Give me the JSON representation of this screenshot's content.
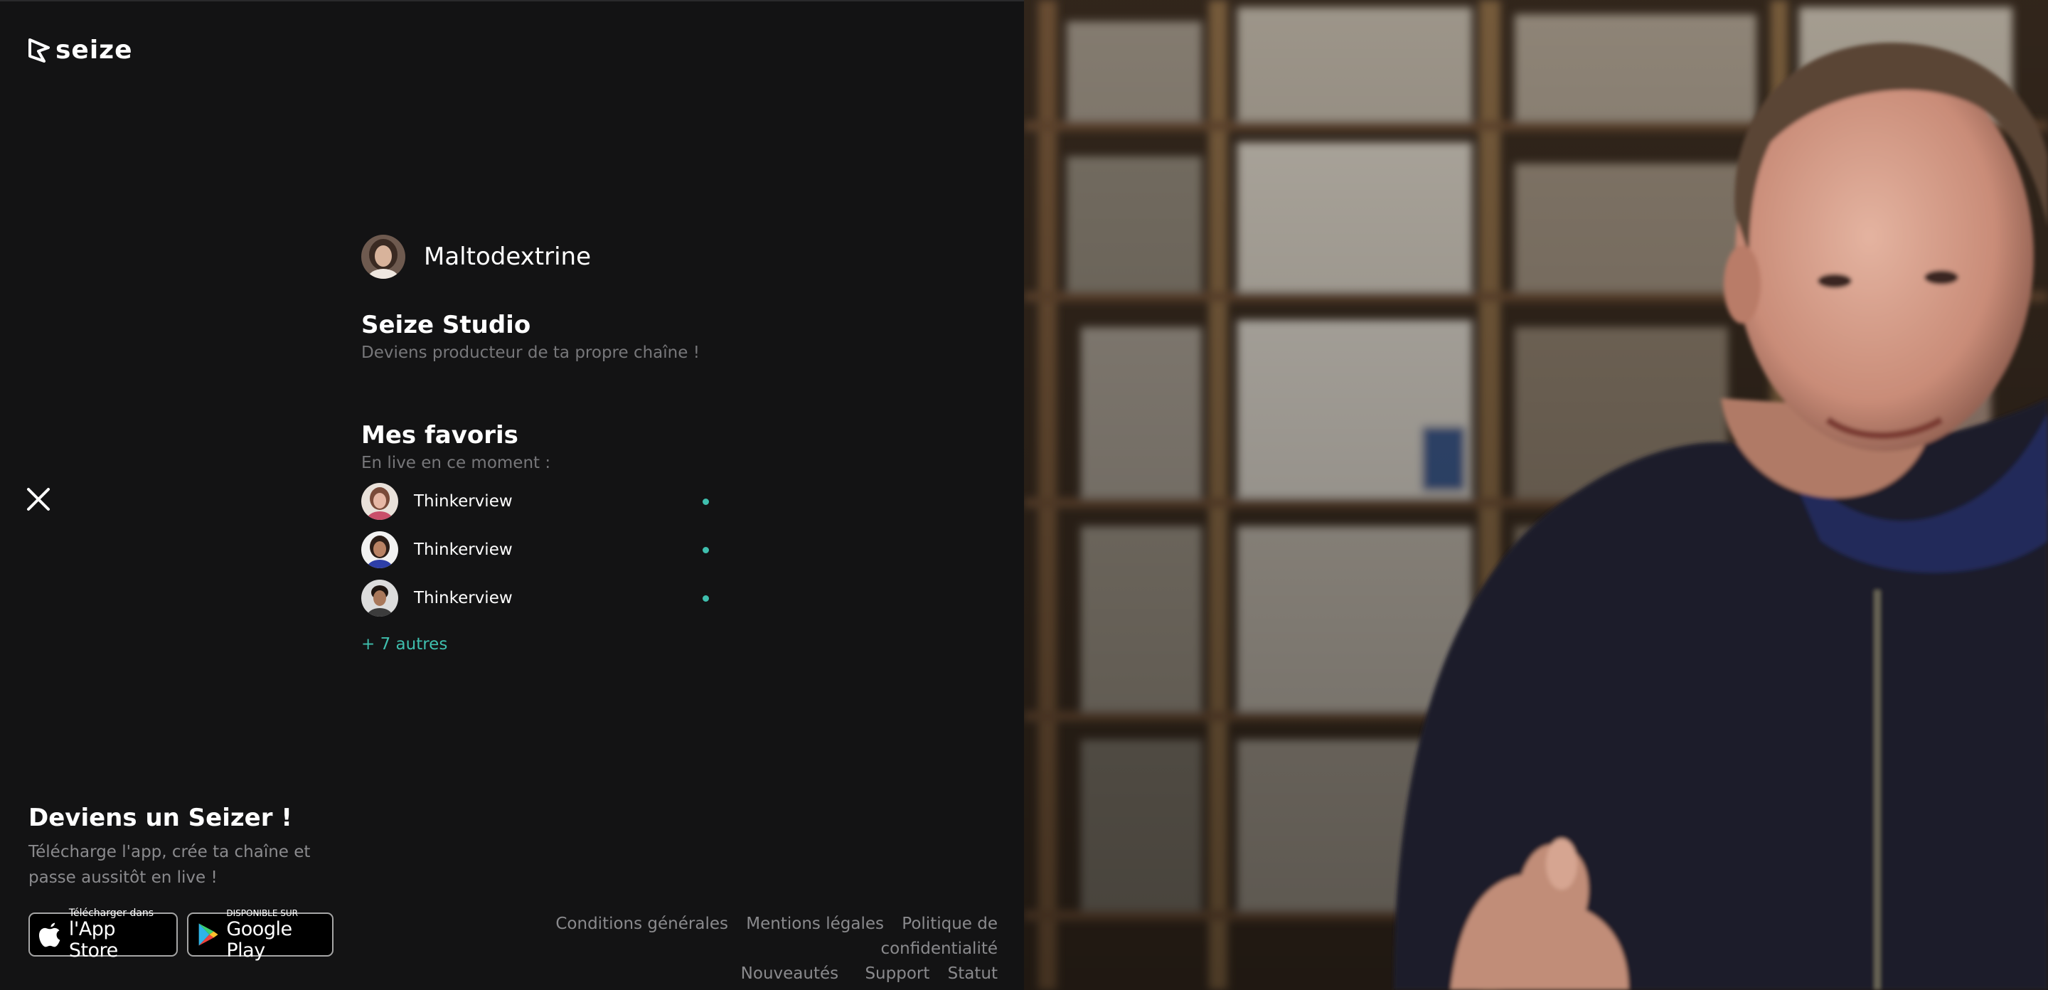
{
  "brand": {
    "name": "seize"
  },
  "profile": {
    "name": "Maltodextrine"
  },
  "studio": {
    "title": "Seize Studio",
    "subtitle": "Deviens producteur de ta propre chaîne !"
  },
  "favorites": {
    "title": "Mes favoris",
    "subtitle": "En live en ce moment :",
    "items": [
      {
        "name": "Thinkerview",
        "live": true
      },
      {
        "name": "Thinkerview",
        "live": true
      },
      {
        "name": "Thinkerview",
        "live": true
      }
    ],
    "more": "+ 7 autres"
  },
  "cta": {
    "title": "Deviens un Seizer !",
    "description": "Télécharge l'app, crée ta chaîne et passe aussitôt en live !"
  },
  "stores": {
    "apple": {
      "small": "Télécharger dans",
      "big": "l'App Store"
    },
    "google": {
      "small": "DISPONIBLE SUR",
      "big": "Google Play"
    }
  },
  "footer": {
    "row1": [
      "Conditions générales",
      "Mentions légales",
      "Politique de confidentialité"
    ],
    "row2": [
      "Nouveautés",
      "Support",
      "Statut"
    ]
  },
  "colors": {
    "background": "#131314",
    "accent": "#3fbfae",
    "muted_text": "#77777a"
  }
}
